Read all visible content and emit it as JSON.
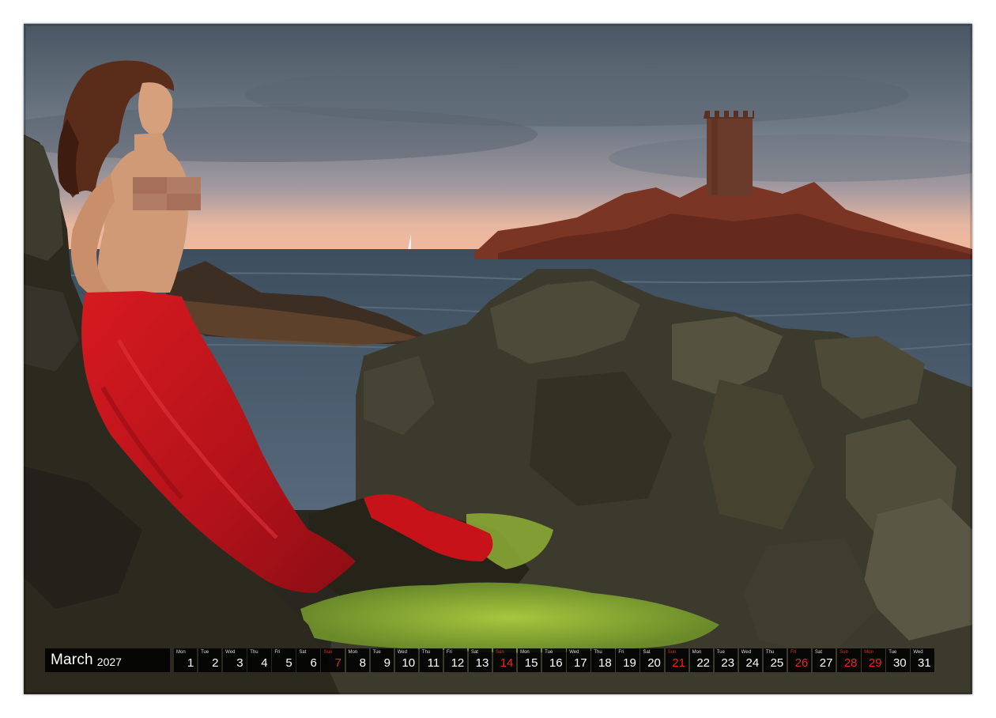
{
  "calendar": {
    "month": "March",
    "year": "2027",
    "days": [
      {
        "dow": "Mon",
        "num": "1",
        "red": false
      },
      {
        "dow": "Tue",
        "num": "2",
        "red": false
      },
      {
        "dow": "Wed",
        "num": "3",
        "red": false
      },
      {
        "dow": "Thu",
        "num": "4",
        "red": false
      },
      {
        "dow": "Fri",
        "num": "5",
        "red": false
      },
      {
        "dow": "Sat",
        "num": "6",
        "red": false
      },
      {
        "dow": "Sun",
        "num": "7",
        "red": true
      },
      {
        "dow": "Mon",
        "num": "8",
        "red": false
      },
      {
        "dow": "Tue",
        "num": "9",
        "red": false
      },
      {
        "dow": "Wed",
        "num": "10",
        "red": false
      },
      {
        "dow": "Thu",
        "num": "11",
        "red": false
      },
      {
        "dow": "Fri",
        "num": "12",
        "red": false
      },
      {
        "dow": "Sat",
        "num": "13",
        "red": false
      },
      {
        "dow": "Sun",
        "num": "14",
        "red": true
      },
      {
        "dow": "Mon",
        "num": "15",
        "red": false
      },
      {
        "dow": "Tue",
        "num": "16",
        "red": false
      },
      {
        "dow": "Wed",
        "num": "17",
        "red": false
      },
      {
        "dow": "Thu",
        "num": "18",
        "red": false
      },
      {
        "dow": "Fri",
        "num": "19",
        "red": false
      },
      {
        "dow": "Sat",
        "num": "20",
        "red": false
      },
      {
        "dow": "Sun",
        "num": "21",
        "red": true
      },
      {
        "dow": "Mon",
        "num": "22",
        "red": false
      },
      {
        "dow": "Tue",
        "num": "23",
        "red": false
      },
      {
        "dow": "Wed",
        "num": "24",
        "red": false
      },
      {
        "dow": "Thu",
        "num": "25",
        "red": false
      },
      {
        "dow": "Fri",
        "num": "26",
        "red": true
      },
      {
        "dow": "Sat",
        "num": "27",
        "red": false
      },
      {
        "dow": "Sun",
        "num": "28",
        "red": true
      },
      {
        "dow": "Mon",
        "num": "29",
        "red": true
      },
      {
        "dow": "Tue",
        "num": "30",
        "red": false
      },
      {
        "dow": "Wed",
        "num": "31",
        "red": false
      }
    ]
  },
  "colors": {
    "holiday_red": "#e8271c",
    "strip_bg": "#000000",
    "dress_red": "#c8141a"
  }
}
